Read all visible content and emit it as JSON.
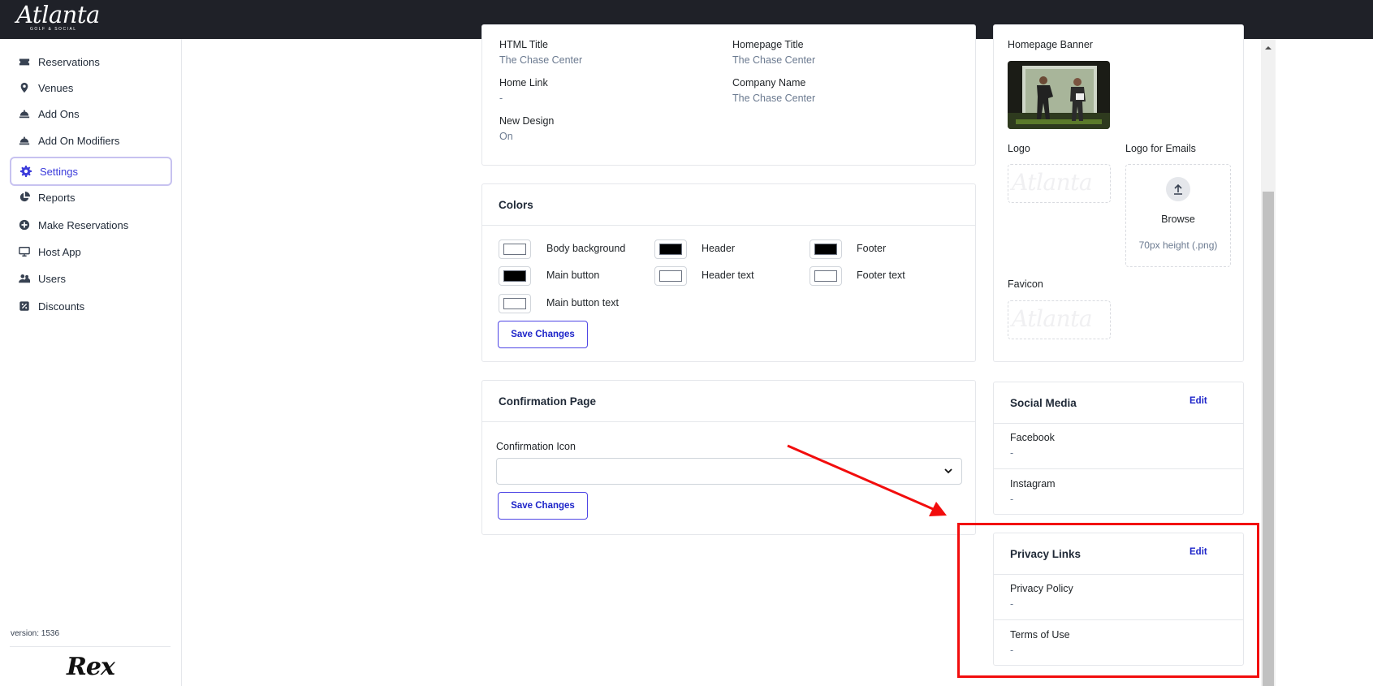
{
  "brand": {
    "name": "Atlanta",
    "tagline": "GOLF & SOCIAL"
  },
  "sidebar": {
    "items": [
      {
        "label": "Reservations",
        "icon": "ticket-icon"
      },
      {
        "label": "Venues",
        "icon": "map-pin-icon"
      },
      {
        "label": "Add Ons",
        "icon": "food-tray-icon"
      },
      {
        "label": "Add On Modifiers",
        "icon": "food-tray-icon"
      },
      {
        "label": "Settings",
        "icon": "gear-icon",
        "active": true
      },
      {
        "label": "Reports",
        "icon": "pie-chart-icon"
      },
      {
        "label": "Make Reservations",
        "icon": "plus-circle-icon"
      },
      {
        "label": "Host App",
        "icon": "monitor-icon"
      },
      {
        "label": "Users",
        "icon": "users-icon"
      },
      {
        "label": "Discounts",
        "icon": "percent-tag-icon"
      }
    ],
    "version": "version: 1536",
    "footer_logo": "Rex"
  },
  "general": {
    "html_title_label": "HTML Title",
    "html_title_value": "The Chase Center",
    "homepage_title_label": "Homepage Title",
    "homepage_title_value": "The Chase Center",
    "home_link_label": "Home Link",
    "home_link_value": "-",
    "company_name_label": "Company Name",
    "company_name_value": "The Chase Center",
    "new_design_label": "New Design",
    "new_design_value": "On"
  },
  "colors": {
    "title": "Colors",
    "items": [
      {
        "label": "Body background",
        "color": "#ffffff"
      },
      {
        "label": "Header",
        "color": "#000000"
      },
      {
        "label": "Footer",
        "color": "#000000"
      },
      {
        "label": "Main button",
        "color": "#000000"
      },
      {
        "label": "Header text",
        "color": "#ffffff"
      },
      {
        "label": "Footer text",
        "color": "#ffffff"
      },
      {
        "label": "Main button text",
        "color": "#ffffff"
      }
    ],
    "save_label": "Save Changes"
  },
  "confirmation": {
    "title": "Confirmation Page",
    "icon_label": "Confirmation Icon",
    "icon_value": "",
    "save_label": "Save Changes"
  },
  "images": {
    "homepage_banner_label": "Homepage Banner",
    "logo_label": "Logo",
    "logo_for_emails_label": "Logo for Emails",
    "browse_label": "Browse",
    "browse_hint": "70px height (.png)",
    "favicon_label": "Favicon",
    "faint_logo_text": "Atlanta"
  },
  "social_media": {
    "title": "Social Media",
    "edit_label": "Edit",
    "facebook_label": "Facebook",
    "facebook_value": "-",
    "instagram_label": "Instagram",
    "instagram_value": "-"
  },
  "privacy_links": {
    "title": "Privacy Links",
    "edit_label": "Edit",
    "privacy_policy_label": "Privacy Policy",
    "privacy_policy_value": "-",
    "terms_label": "Terms of Use",
    "terms_value": "-"
  },
  "theme": {
    "topbar": "#1f2128",
    "accent": "#1d24c9",
    "annotation": "#f20d0d"
  }
}
